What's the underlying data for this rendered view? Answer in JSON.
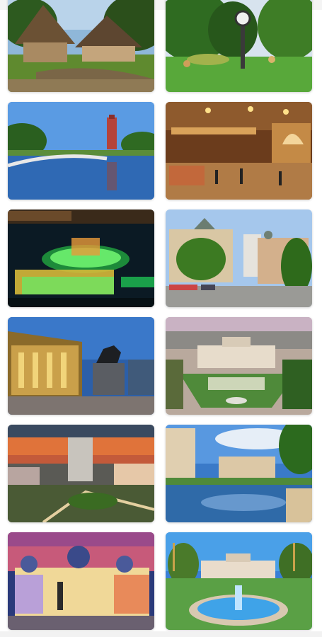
{
  "gallery": {
    "photos": [
      {
        "subject": "village-museum-thatched-houses"
      },
      {
        "subject": "park-clock"
      },
      {
        "subject": "lake-bridge-monument"
      },
      {
        "subject": "historic-restaurant-interior"
      },
      {
        "subject": "night-fountain-show"
      },
      {
        "subject": "street-with-old-buildings"
      },
      {
        "subject": "equestrian-statue-palace"
      },
      {
        "subject": "parliament-palace-aerial"
      },
      {
        "subject": "city-sunset-skyline"
      },
      {
        "subject": "river-embankment"
      },
      {
        "subject": "domed-library-sunset"
      },
      {
        "subject": "palace-fountain-boulevard"
      }
    ]
  },
  "colors": {
    "background": "#ffffff",
    "tile_shadow": "#bdbdbd"
  }
}
